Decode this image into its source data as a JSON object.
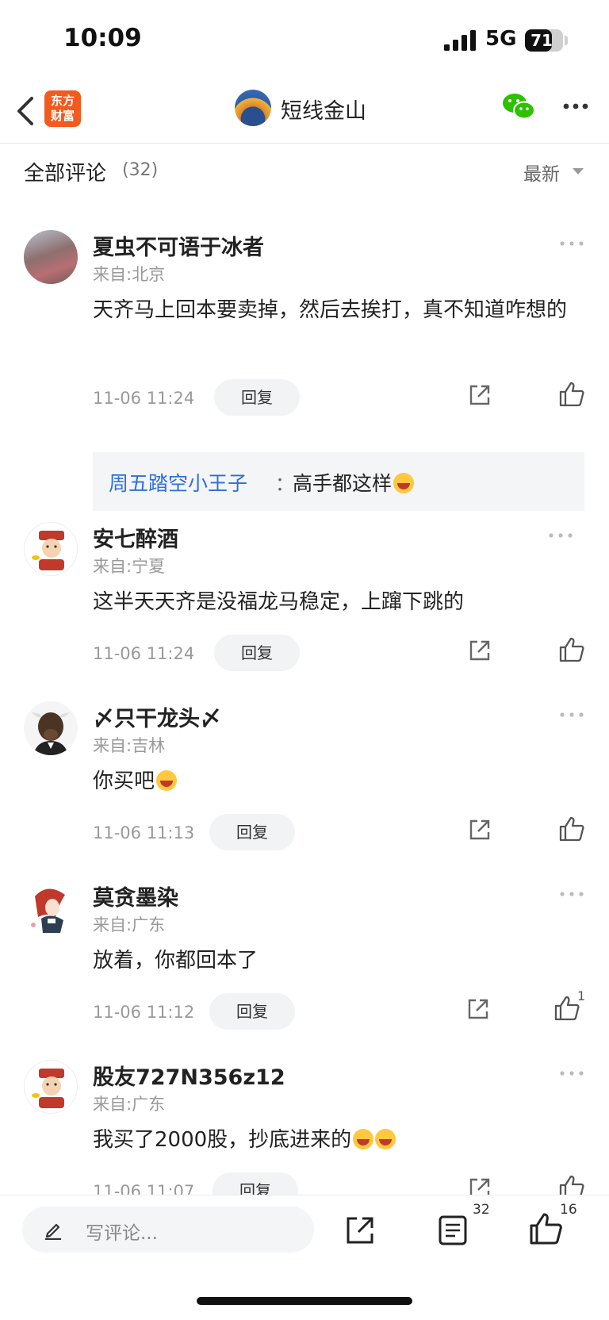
{
  "status_bar": {
    "time": "10:09",
    "network": "5G",
    "battery": "71",
    "battery_level": 0.71
  },
  "nav": {
    "logo_text": "东方\n财富",
    "channel_name": "短线金山"
  },
  "comments_header": {
    "title": "全部评论",
    "count": "(32)",
    "sort": "最新"
  },
  "comments": [
    {
      "name": "夏虫不可语于冰者",
      "location": "来自:北京",
      "text": "天齐马上回本要卖掉，然后去挨打，真不知道咋想的",
      "time": "11-06 11:24",
      "reply_label": "回复",
      "sub_reply": {
        "author": "周五踏空小王子",
        "sep": "：",
        "text": "高手都这样"
      }
    },
    {
      "name": "安七醉酒",
      "location": "来自:宁夏",
      "text": "这半天天齐是没福龙马稳定，上蹿下跳的",
      "time": "11-06 11:24",
      "reply_label": "回复"
    },
    {
      "name": "〆只干龙头〆",
      "location": "来自:吉林",
      "text": "你买吧",
      "time": "11-06 11:13",
      "reply_label": "回复"
    },
    {
      "name": "莫贪墨染",
      "location": "来自:广东",
      "text": "放着，你都回本了",
      "time": "11-06 11:12",
      "reply_label": "回复",
      "like_count": "1"
    },
    {
      "name": "股友727N356z12",
      "location": "来自:广东",
      "text": "我买了2000股，抄底进来的",
      "time": "11-06 11:07",
      "reply_label": "回复"
    }
  ],
  "bottom_bar": {
    "placeholder": "写评论...",
    "comments_count": "32",
    "likes_count": "16"
  },
  "colors": {
    "accent_blue": "#2e6fdc",
    "logo_orange": "#f25a1e",
    "wechat_green": "#2dc100"
  },
  "icons": [
    "back-icon",
    "wechat-icon",
    "more-icon",
    "share-icon",
    "like-icon",
    "pen-icon",
    "comments-icon"
  ]
}
